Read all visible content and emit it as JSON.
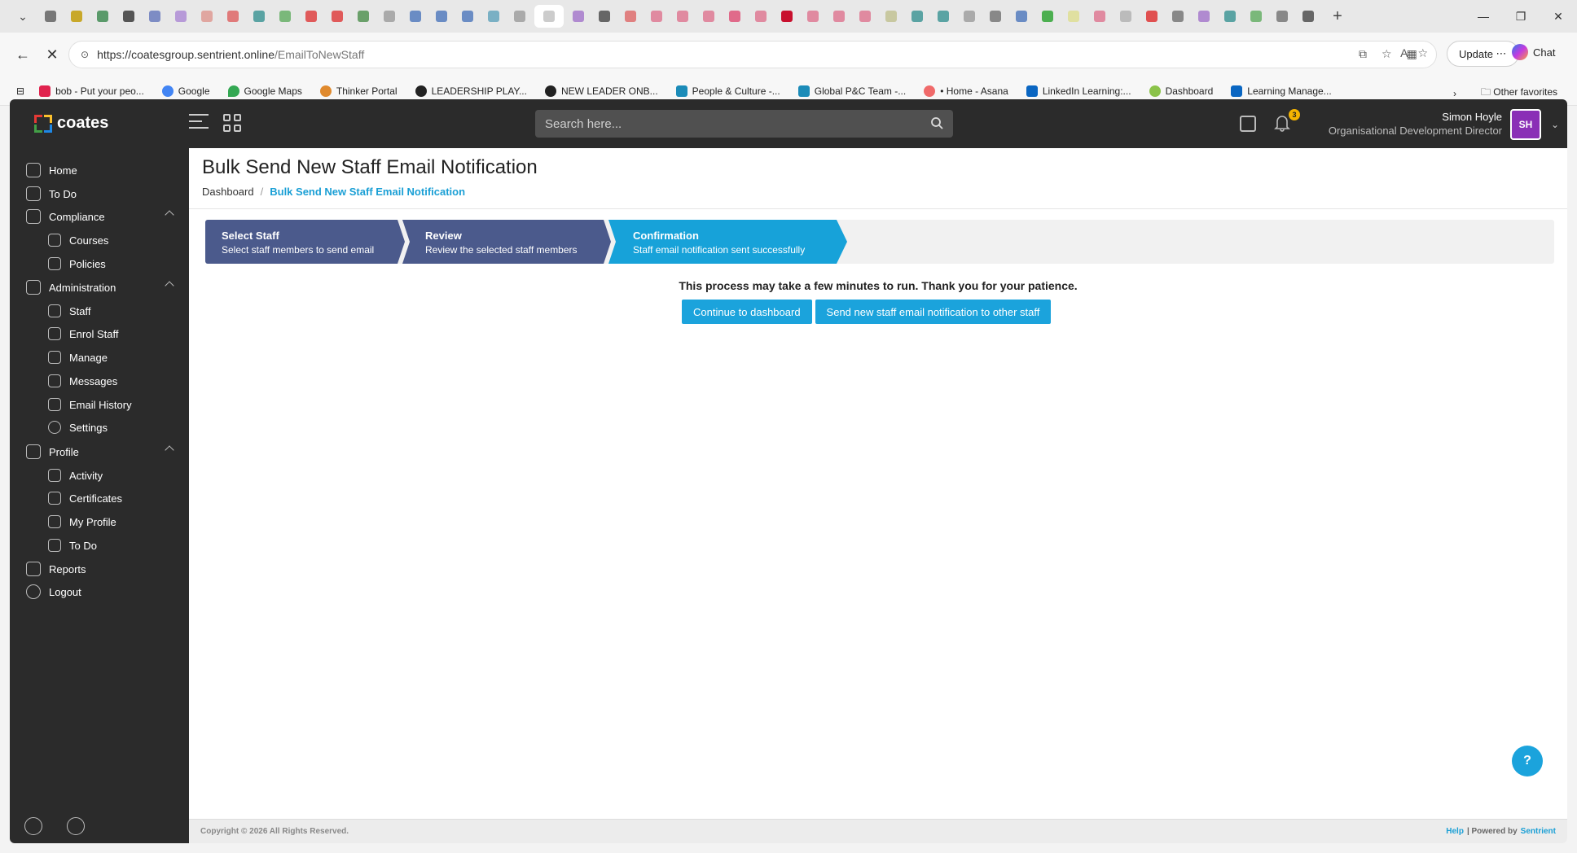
{
  "browser": {
    "url_host": "https://coatesgroup.sentrient.online",
    "url_path": "/EmailToNewStaff",
    "update_label": "Update",
    "chat_label": "Chat",
    "bookmarks": [
      {
        "label": "bob - Put your peo...",
        "color": "#e0234e"
      },
      {
        "label": "Google",
        "color": "#4285f4"
      },
      {
        "label": "Google Maps",
        "color": "#34a853"
      },
      {
        "label": "Thinker Portal",
        "color": "#e08a2e"
      },
      {
        "label": "LEADERSHIP PLAY...",
        "color": "#222222"
      },
      {
        "label": "NEW LEADER ONB...",
        "color": "#222222"
      },
      {
        "label": "People & Culture -...",
        "color": "#1b8bb8"
      },
      {
        "label": "Global P&C Team -...",
        "color": "#1b8bb8"
      },
      {
        "label": "• Home - Asana",
        "color": "#f06a6a"
      },
      {
        "label": "LinkedIn Learning:...",
        "color": "#0a66c2"
      },
      {
        "label": "Dashboard",
        "color": "#8bc34a"
      },
      {
        "label": "Learning Manage...",
        "color": "#0a66c2"
      }
    ],
    "other_favorites": "Other favorites"
  },
  "app": {
    "brand": "coates",
    "search_placeholder": "Search here...",
    "notification_count": "3",
    "user": {
      "name": "Simon Hoyle",
      "role": "Organisational Development Director",
      "initials": "SH"
    }
  },
  "sidebar": {
    "home": "Home",
    "todo": "To Do",
    "compliance": "Compliance",
    "courses": "Courses",
    "policies": "Policies",
    "administration": "Administration",
    "staff": "Staff",
    "enrol_staff": "Enrol Staff",
    "manage": "Manage",
    "messages": "Messages",
    "email_history": "Email History",
    "settings": "Settings",
    "profile": "Profile",
    "activity": "Activity",
    "certificates": "Certificates",
    "my_profile": "My Profile",
    "profile_todo": "To Do",
    "reports": "Reports",
    "logout": "Logout"
  },
  "page": {
    "title": "Bulk Send New Staff Email Notification",
    "breadcrumb_home": "Dashboard",
    "breadcrumb_sep": "/",
    "breadcrumb_current": "Bulk Send New Staff Email Notification"
  },
  "wizard": [
    {
      "title": "Select Staff",
      "desc": "Select staff members to send email"
    },
    {
      "title": "Review",
      "desc": "Review the selected staff members"
    },
    {
      "title": "Confirmation",
      "desc": "Staff email notification sent successfully"
    }
  ],
  "main": {
    "notice": "This process may take a few minutes to run. Thank you for your patience.",
    "continue_label": "Continue to dashboard",
    "send_other_label": "Send new staff email notification to other staff"
  },
  "footer": {
    "copyright": "Copyright © 2026 All Rights Reserved.",
    "help": "Help",
    "powered_by": "| Powered by",
    "vendor": "Sentrient"
  },
  "colors": {
    "accent": "#1ba3dc",
    "step_done": "#4b5a8c",
    "avatar": "#8a2fb6"
  }
}
